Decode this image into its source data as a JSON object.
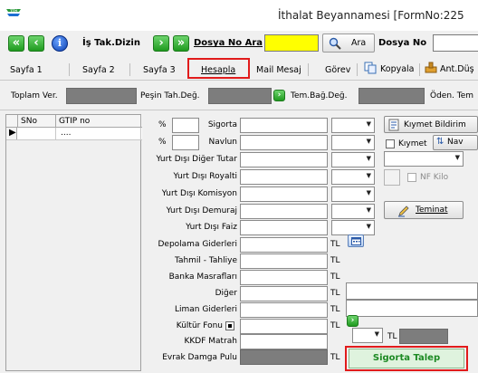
{
  "window": {
    "title": "İthalat Beyannamesi [FormNo:225"
  },
  "toolbar": {
    "is_takip_label": "İş Tak.Dizin",
    "dosya_no_ara_label": "Dosya No Ara",
    "ara_label": "Ara",
    "dosya_no_label": "Dosya No"
  },
  "tabs": [
    "Sayfa 1",
    "Sayfa 2",
    "Sayfa 3",
    "Hesapla",
    "Mail Mesaj",
    "Görev",
    "Kopyala",
    "Ant.Düş"
  ],
  "summary": {
    "toplam_ver": "Toplam Ver.",
    "pesin_tah": "Peşin Tah.Değ.",
    "tem_bag": "Tem.Bağ.Değ.",
    "oden_tem": "Öden. Tem"
  },
  "grid": {
    "columns": [
      "SNo",
      "GTIP no"
    ],
    "rows": [
      {
        "sno": "",
        "gtip": "...."
      }
    ]
  },
  "form": {
    "pct": "%",
    "sigorta": "Sigorta",
    "navlun": "Navlun",
    "yd_diger": "Yurt Dışı Diğer Tutar",
    "yd_royalti": "Yurt Dışı Royalti",
    "yd_komisyon": "Yurt Dışı Komisyon",
    "yd_demuraj": "Yurt Dışı Demuraj",
    "yd_faiz": "Yurt Dışı Faiz",
    "depolama": "Depolama Giderleri",
    "tahmil": "Tahmil - Tahliye",
    "banka": "Banka Masrafları",
    "diger": "Diğer",
    "liman": "Liman Giderleri",
    "kultur": "Kültür Fonu",
    "kkdf": "KKDF Matrah",
    "evrak": "Evrak Damga Pulu",
    "tl": "TL"
  },
  "right": {
    "kiymet_bildirim": "Kıymet Bildirim",
    "kiymet": "Kıymet",
    "nav": "Nav",
    "nf_kilo": "NF Kilo",
    "teminat": "Teminat",
    "sigorta_talep": "Sigorta Talep"
  }
}
